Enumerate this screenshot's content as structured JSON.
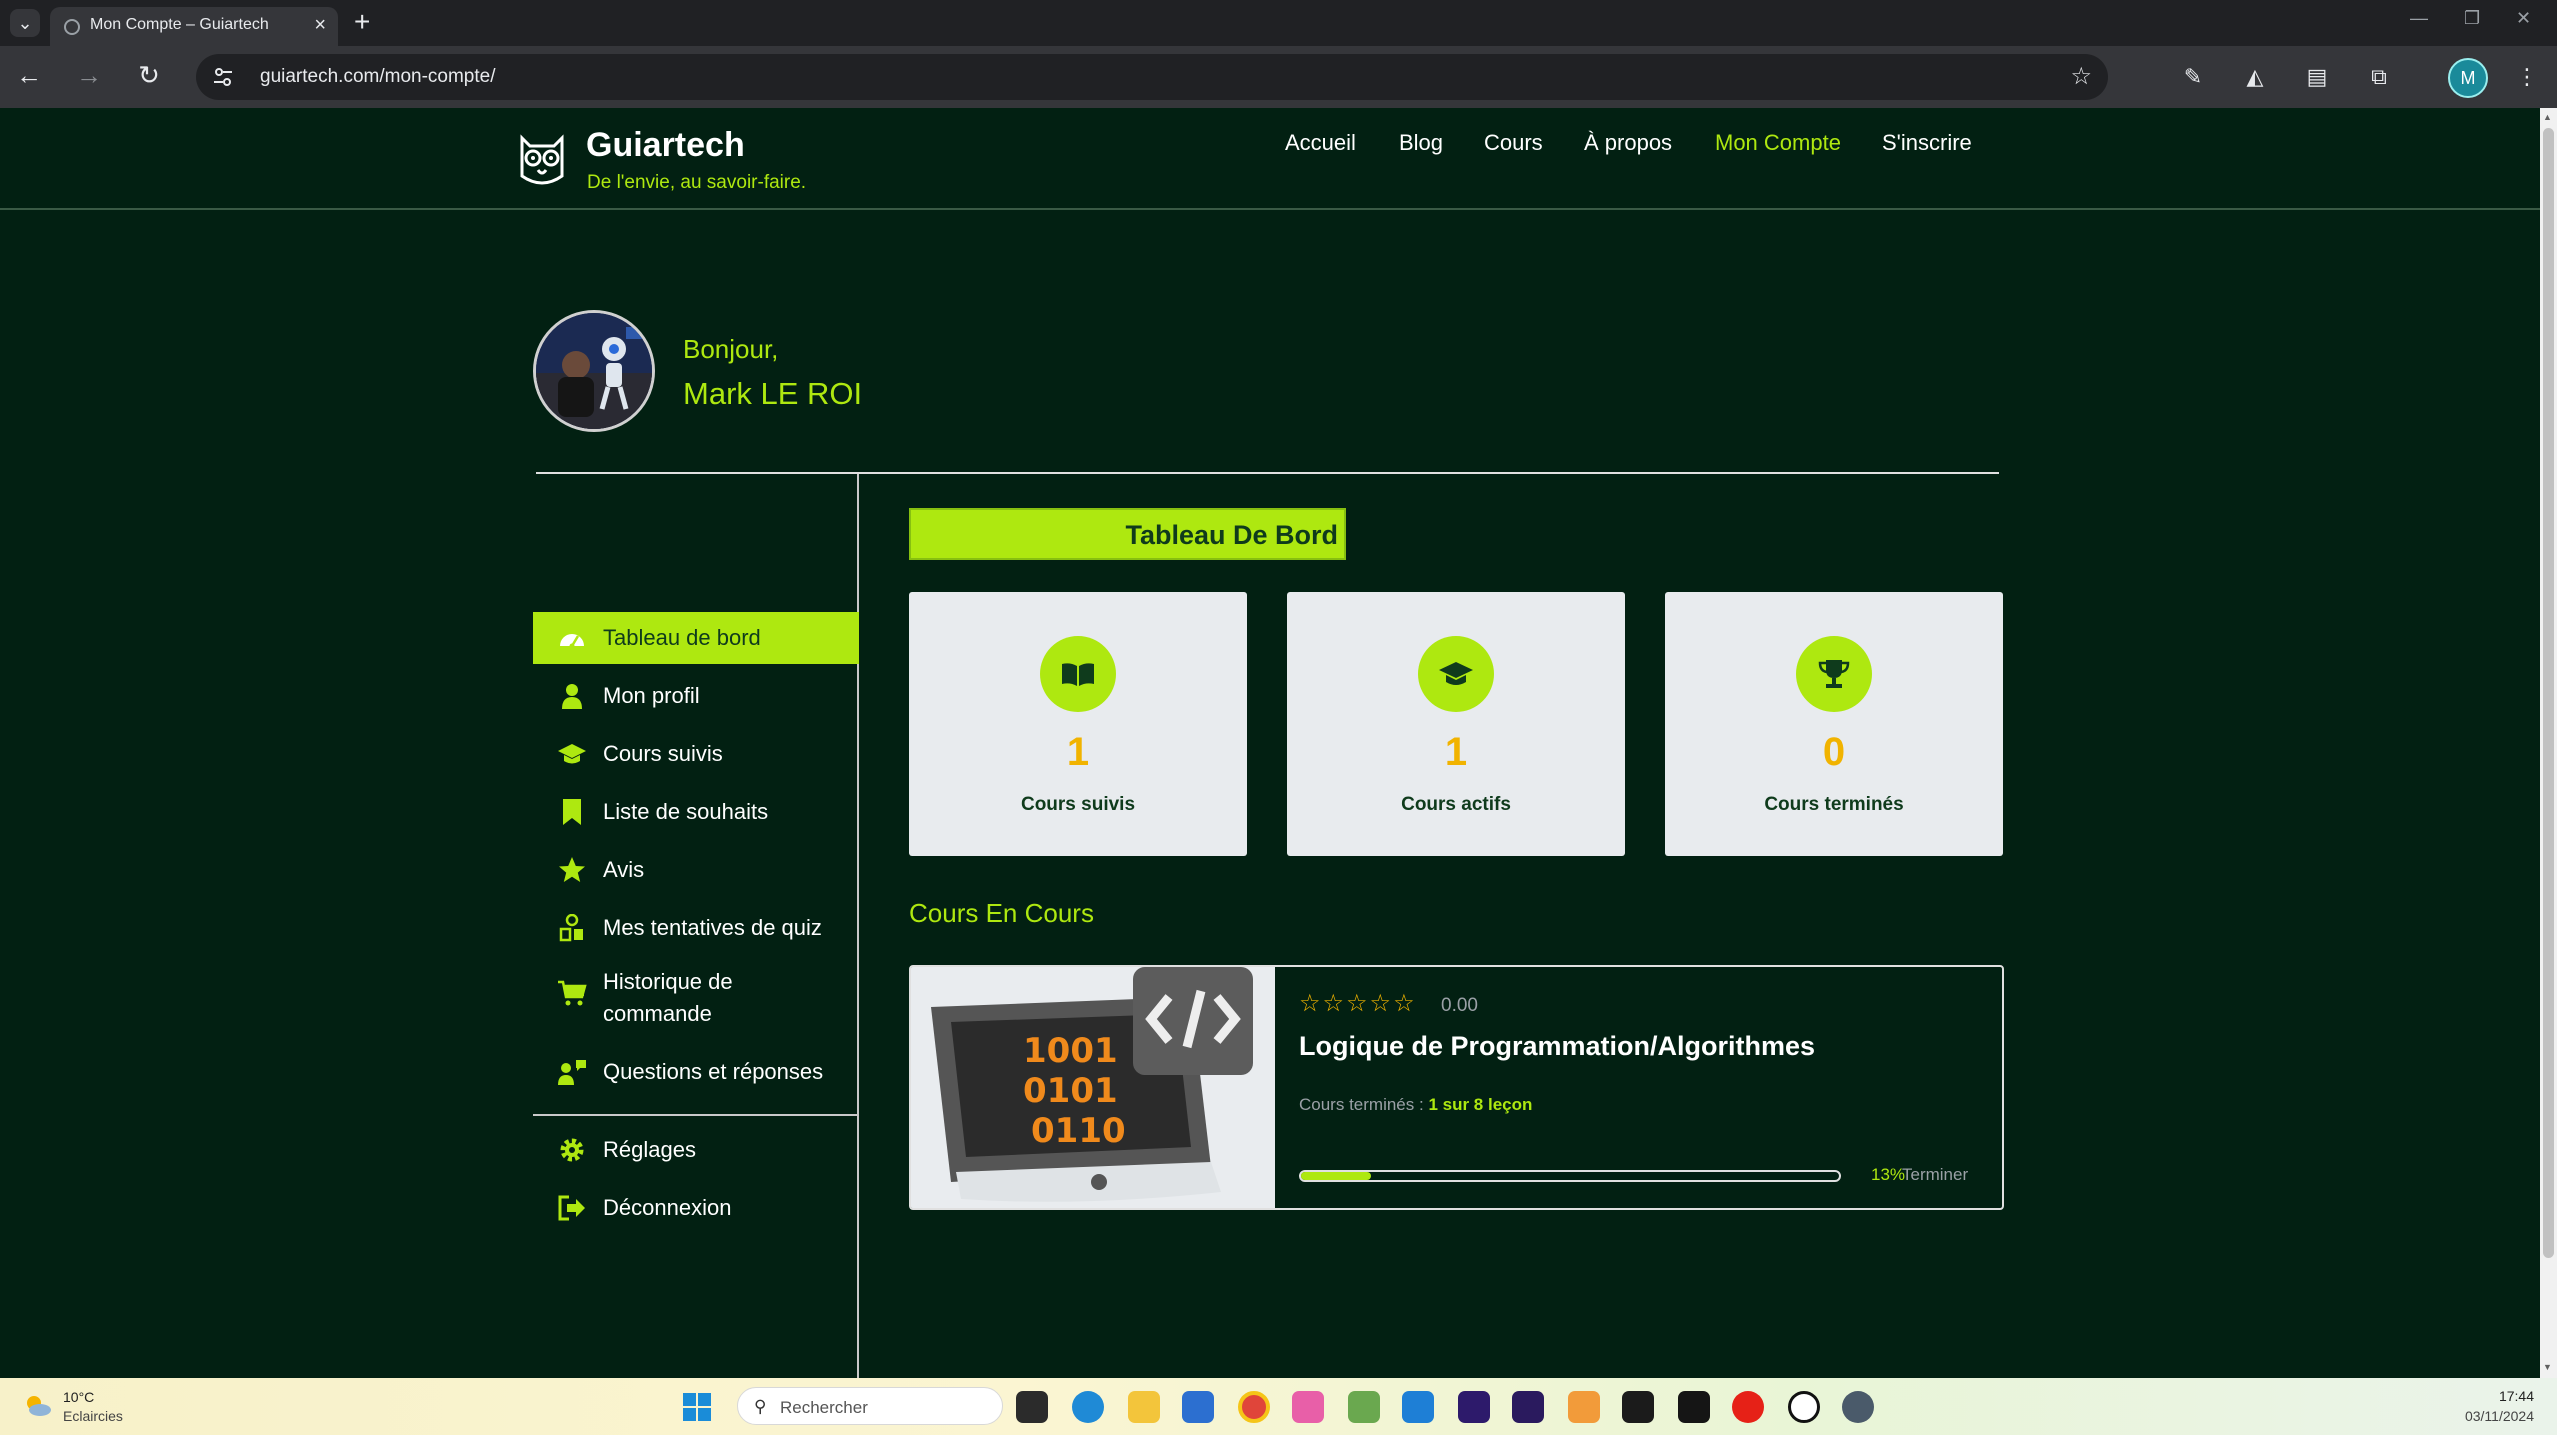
{
  "browser": {
    "tab_title": "Mon Compte – Guiartech",
    "url": "guiartech.com/mon-compte/",
    "profile_initial": "M"
  },
  "site": {
    "title": "Guiartech",
    "tagline": "De l'envie, au savoir-faire.",
    "nav": [
      "Accueil",
      "Blog",
      "Cours",
      "À propos",
      "Mon Compte",
      "S'inscrire"
    ],
    "active_nav": "Mon Compte"
  },
  "user": {
    "greeting": "Bonjour,",
    "name": "Mark LE ROI"
  },
  "sidebar": {
    "items": [
      {
        "label": "Tableau de bord",
        "icon": "dashboard-icon"
      },
      {
        "label": "Mon profil",
        "icon": "user-icon"
      },
      {
        "label": "Cours suivis",
        "icon": "graduation-cap-icon"
      },
      {
        "label": "Liste de souhaits",
        "icon": "bookmark-icon"
      },
      {
        "label": "Avis",
        "icon": "star-icon"
      },
      {
        "label": "Mes tentatives de quiz",
        "icon": "quiz-icon"
      },
      {
        "label": "Historique de commande",
        "icon": "cart-icon"
      },
      {
        "label": "Questions et réponses",
        "icon": "question-answer-icon"
      },
      {
        "label": "Réglages",
        "icon": "gear-icon"
      },
      {
        "label": "Déconnexion",
        "icon": "logout-icon"
      }
    ]
  },
  "dashboard": {
    "title": "Tableau De Bord",
    "stats": [
      {
        "value": "1",
        "label": "Cours suivis",
        "icon": "book-icon"
      },
      {
        "value": "1",
        "label": "Cours actifs",
        "icon": "graduation-cap-icon"
      },
      {
        "value": "0",
        "label": "Cours terminés",
        "icon": "trophy-icon"
      }
    ]
  },
  "in_progress": {
    "title": "Cours En Cours",
    "course": {
      "rating_stars": "☆☆☆☆☆",
      "rating": "0.00",
      "name": "Logique de Programmation/Algorithmes",
      "done_label": "Cours terminés :",
      "done_value": "1 sur 8 leçon",
      "progress": 0.13,
      "progress_text": "13%",
      "action": "Terminer"
    }
  },
  "taskbar": {
    "temperature": "10°C",
    "weather": "Eclaircies",
    "search_placeholder": "Rechercher",
    "time": "17:44",
    "date": "03/11/2024"
  },
  "colors": {
    "accent": "#aee810",
    "page_bg": "#022012",
    "stat_value": "#f1b300"
  }
}
